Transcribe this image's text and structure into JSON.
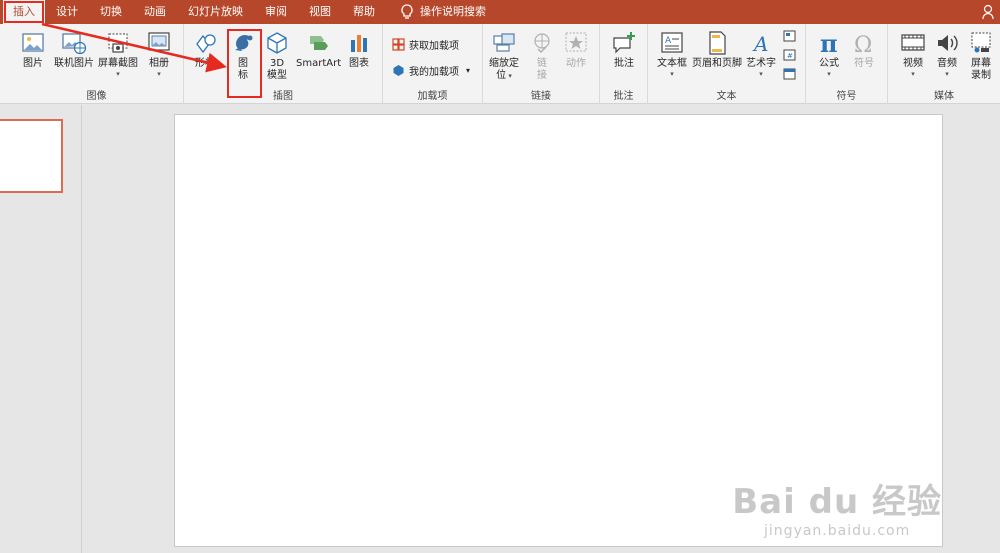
{
  "tabs": [
    "插入",
    "设计",
    "切换",
    "动画",
    "幻灯片放映",
    "审阅",
    "视图",
    "帮助"
  ],
  "search_label": "操作说明搜索",
  "groups": {
    "image": {
      "label": "图像",
      "pictures": "图片",
      "online_pictures": "联机图片",
      "screenshot": "屏幕截图",
      "album": "相册"
    },
    "illustrations": {
      "label": "插图",
      "shapes": "形状",
      "icons_line1": "图",
      "icons_line2": "标",
      "model3d_line1": "3D",
      "model3d_line2": "模型",
      "smartart": "SmartArt",
      "chart": "图表"
    },
    "addins": {
      "label": "加载项",
      "get_addins": "获取加载项",
      "my_addins": "我的加载项"
    },
    "links": {
      "label": "链接",
      "zoom_line1": "缩放定",
      "zoom_line2": "位",
      "link_line1": "链",
      "link_line2": "接",
      "action": "动作"
    },
    "comments": {
      "label": "批注",
      "comment": "批注"
    },
    "text": {
      "label": "文本",
      "textbox": "文本框",
      "header_footer": "页眉和页脚",
      "wordart": "艺术字"
    },
    "symbols": {
      "label": "符号",
      "equation": "公式",
      "symbol": "符号"
    },
    "media": {
      "label": "媒体",
      "video": "视频",
      "audio": "音频",
      "screen_rec_line1": "屏幕",
      "screen_rec_line2": "录制"
    }
  },
  "watermark": {
    "logo": "Bai du 经验",
    "url": "jingyan.baidu.com"
  },
  "colors": {
    "accent": "#b7472a",
    "highlight": "#e52a1f"
  }
}
